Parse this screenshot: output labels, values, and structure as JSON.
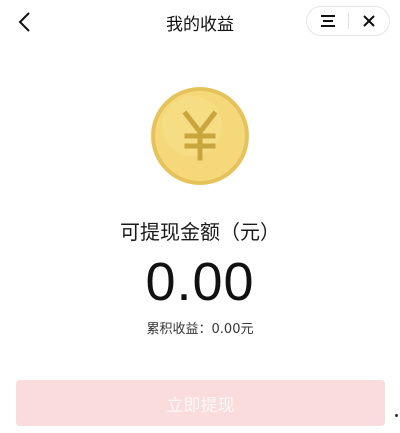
{
  "nav": {
    "title": "我的收益",
    "back_icon": "chevron-left-icon",
    "menu_icon": "menu-icon",
    "close_icon": "close-icon"
  },
  "earnings": {
    "coin_icon": "yuan-coin-icon",
    "coin_symbol": "¥",
    "label": "可提现金额（元）",
    "amount": "0.00",
    "total_label": "累积收益：0.00元"
  },
  "actions": {
    "withdraw_label": "立即提现",
    "withdraw_enabled": false
  },
  "colors": {
    "coin_fill": "#f5d879",
    "coin_rim": "#e6c35a",
    "coin_symbol": "#c9a53e",
    "button_bg": "#fadcdc",
    "button_text": "#fff8f8"
  }
}
